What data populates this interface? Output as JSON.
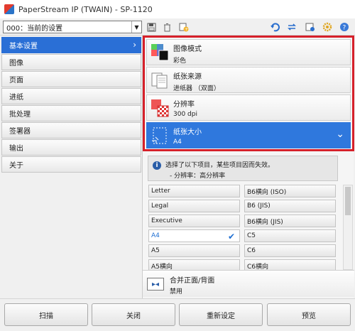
{
  "window": {
    "title": "PaperStream IP (TWAIN) - SP-1120"
  },
  "toolbar": {
    "profile_value": "000：当前的设置",
    "icons": [
      "save-icon",
      "delete-icon",
      "add-profile-icon",
      "undo-icon",
      "swap-icon",
      "scanner-info-icon",
      "settings-icon",
      "help-icon"
    ]
  },
  "nav": {
    "items": [
      {
        "label": "基本设置",
        "active": true
      },
      {
        "label": "图像"
      },
      {
        "label": "页面"
      },
      {
        "label": "进纸"
      },
      {
        "label": "批处理"
      },
      {
        "label": "签署器"
      },
      {
        "label": "输出"
      },
      {
        "label": "关于"
      }
    ]
  },
  "settings": [
    {
      "label": "图像模式",
      "value": "彩色"
    },
    {
      "label": "纸张来源",
      "value": "进纸器 （双面）"
    },
    {
      "label": "分辨率",
      "value": "300 dpi"
    },
    {
      "label": "纸张大小",
      "value": "A4"
    }
  ],
  "info": {
    "line1": "选择了以下项目，某些项目因而失效。",
    "line2": "- 分辨率：高分辨率"
  },
  "paper_sizes": [
    [
      "Letter",
      "B6横向 (ISO)"
    ],
    [
      "Legal",
      "B6 (JIS)"
    ],
    [
      "Executive",
      "B6横向 (JIS)"
    ],
    [
      "A4",
      "C5"
    ],
    [
      "A5",
      "C6"
    ],
    [
      "A5横向",
      "C6横向"
    ]
  ],
  "paper_sizes_selected": "A4",
  "merge": {
    "label": "合并正面/背面",
    "value": "禁用"
  },
  "buttons": {
    "scan": "扫描",
    "close": "关闭",
    "reset": "重新设定",
    "preview": "预览"
  },
  "colors": {
    "selected_blue": "#2f78dd",
    "highlight_red": "#d6202a"
  }
}
